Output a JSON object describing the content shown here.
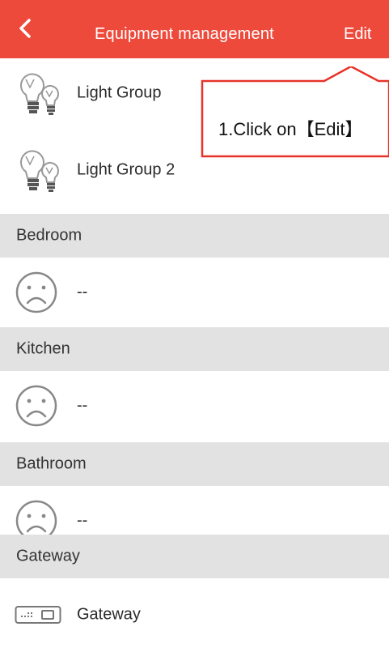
{
  "header": {
    "title": "Equipment management",
    "edit_label": "Edit",
    "color": "#ee4a3c"
  },
  "callout": {
    "text": "1.Click on【Edit】",
    "border_color": "#e8332a"
  },
  "items": [
    {
      "label": "Light Group",
      "icon": "light-bulb-icon"
    },
    {
      "label": "Light Group 2",
      "icon": "light-bulb-icon"
    }
  ],
  "sections": [
    {
      "title": "Bedroom",
      "item_label": "--",
      "item_icon": "sad-face-icon"
    },
    {
      "title": "Kitchen",
      "item_label": "--",
      "item_icon": "sad-face-icon"
    },
    {
      "title": "Bathroom",
      "item_label": "--",
      "item_icon": "sad-face-icon"
    },
    {
      "title": "Gateway",
      "item_label": "Gateway",
      "item_icon": "gateway-device-icon"
    }
  ]
}
